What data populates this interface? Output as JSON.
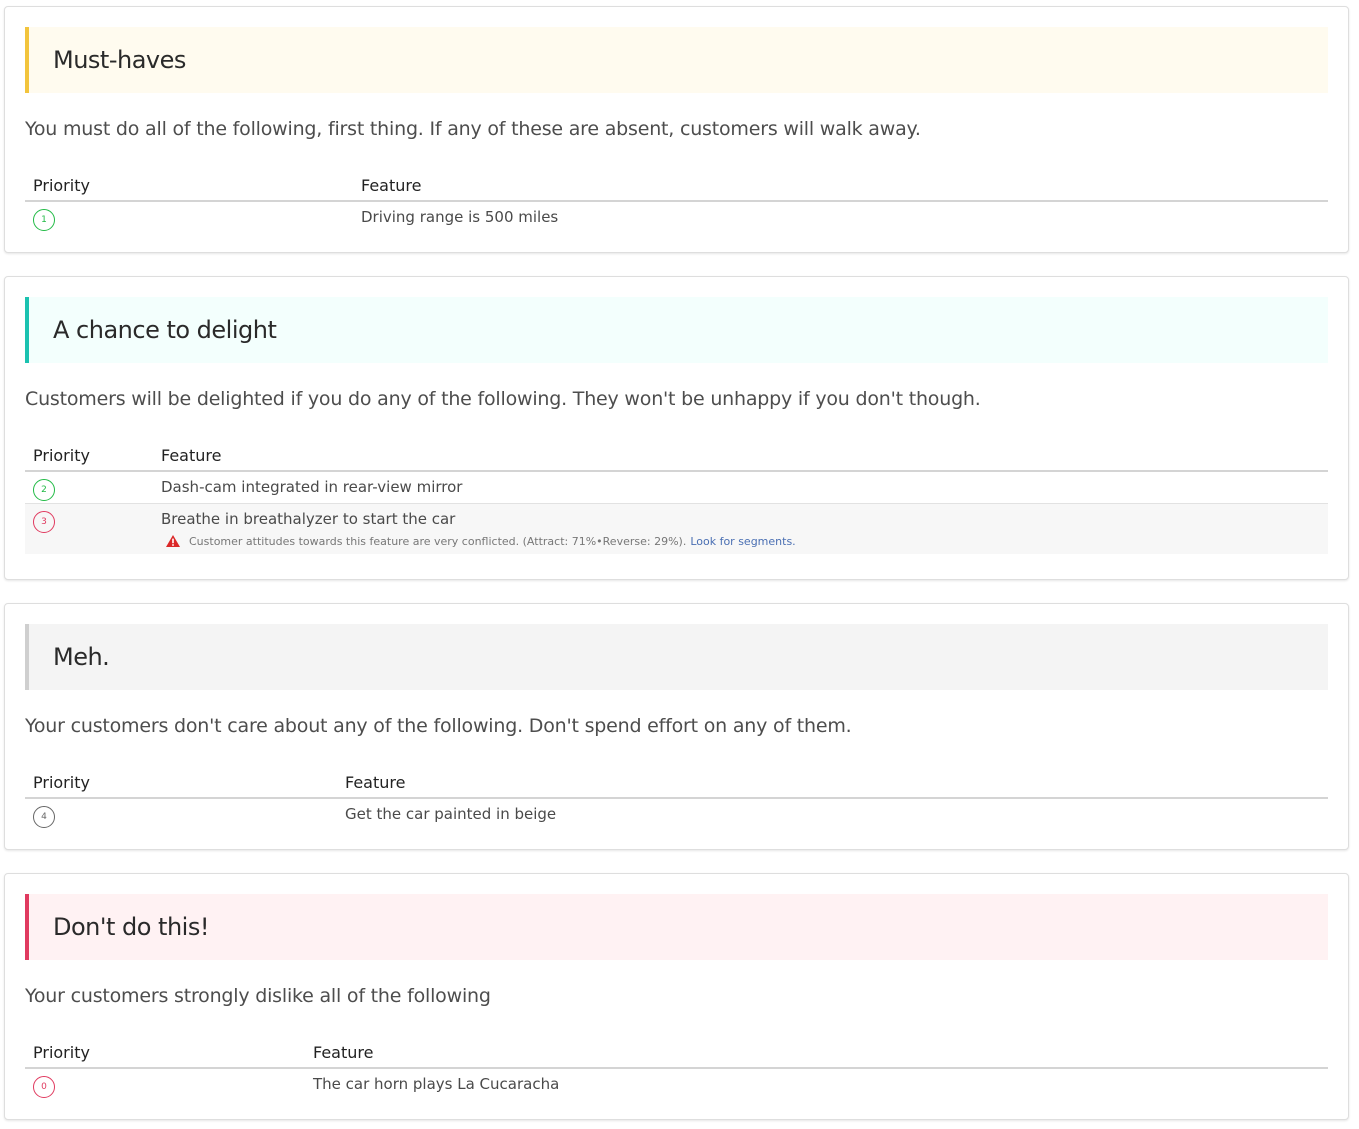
{
  "sections": [
    {
      "title": "Must-haves",
      "accent": "#f2c43c",
      "banner_bg": "#fffbef",
      "description": "You must do all of the following, first thing. If any of these are absent, customers will walk away.",
      "headers": {
        "priority": "Priority",
        "feature": "Feature"
      },
      "rows": [
        {
          "priority": "1",
          "badge_color": "#21ba45",
          "feature": "Driving range is 500 miles"
        }
      ]
    },
    {
      "title": "A chance to delight",
      "accent": "#1bc2b0",
      "banner_bg": "#f3fffd",
      "description": "Customers will be delighted if you do any of the following. They won't be unhappy if you don't though.",
      "headers": {
        "priority": "Priority",
        "feature": "Feature"
      },
      "rows": [
        {
          "priority": "2",
          "badge_color": "#21ba45",
          "feature": "Dash-cam integrated in rear-view mirror"
        },
        {
          "priority": "3",
          "badge_color": "#e03a5f",
          "feature": "Breathe in breathalyzer to start the car",
          "warning": {
            "text": "Customer attitudes towards this feature are very conflicted. (Attract: 71%•Reverse: 29%).",
            "link": "Look for segments.",
            "icon": "warning-icon",
            "color": "#db2828"
          }
        }
      ]
    },
    {
      "title": "Meh.",
      "accent": "#cfcfcf",
      "banner_bg": "#f4f4f4",
      "description": "Your customers don't care about any of the following. Don't spend effort on any of them.",
      "headers": {
        "priority": "Priority",
        "feature": "Feature"
      },
      "rows": [
        {
          "priority": "4",
          "badge_color": "#666666",
          "feature": "Get the car painted in beige"
        }
      ]
    },
    {
      "title": "Don't do this!",
      "accent": "#e03a5f",
      "banner_bg": "#fff2f3",
      "description": "Your customers strongly dislike all of the following",
      "headers": {
        "priority": "Priority",
        "feature": "Feature"
      },
      "rows": [
        {
          "priority": "0",
          "badge_color": "#e03a5f",
          "feature": "The car horn plays La Cucaracha"
        }
      ]
    }
  ]
}
